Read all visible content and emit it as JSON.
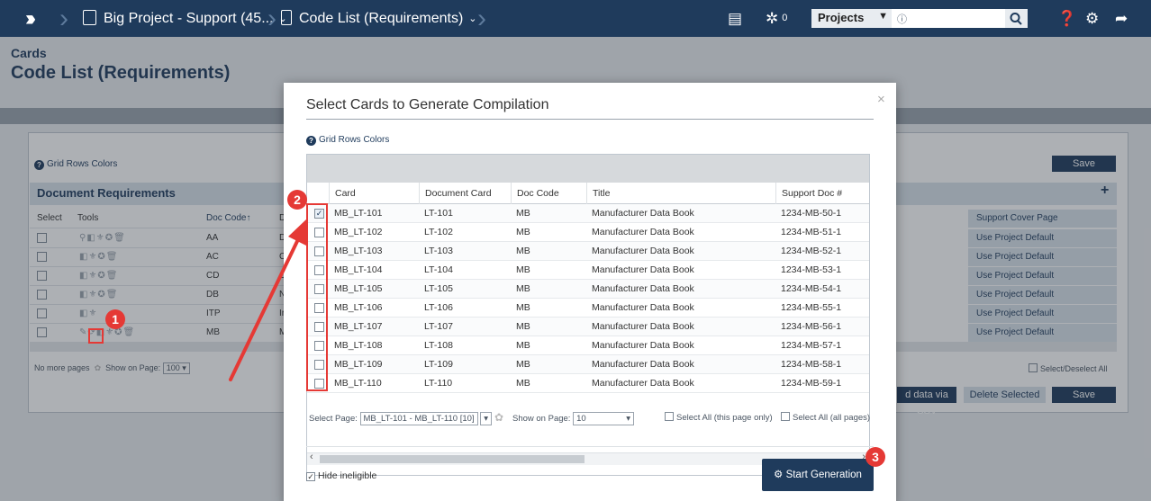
{
  "topnav": {
    "logo_icon": "chevrons-right-logo",
    "crumb1": "Big Project - Support (45...",
    "crumb2": "Code List (Requirements)",
    "notif_count": "0",
    "projects_label": "Projects",
    "search_icon": "search-icon"
  },
  "page": {
    "subtitle": "Cards",
    "title": "Code List (Requirements)",
    "grid_rows_colors": "Grid Rows Colors",
    "save": "Save",
    "section_title": "Document Requirements",
    "columns": {
      "select": "Select",
      "tools": "Tools",
      "doc_code": "Doc Code↑",
      "partial": "D",
      "support_cover": "Support Cover Page"
    },
    "rows": [
      {
        "code": "AA",
        "frag": "D",
        "cover": "Use Project Default"
      },
      {
        "code": "AC",
        "frag": "C",
        "cover": "Use Project Default"
      },
      {
        "code": "CD",
        "frag": "C",
        "cover": "Use Project Default"
      },
      {
        "code": "DB",
        "frag": "N",
        "cover": "Use Project Default"
      },
      {
        "code": "ITP",
        "frag": "Ir",
        "cover": "Use Project Default"
      },
      {
        "code": "MB",
        "frag": "M",
        "cover": "Use Project Default"
      }
    ],
    "pager_text": "No more pages",
    "show_on_page": "Show on Page:",
    "show_on_page_value": "100",
    "select_deselect": "Select/Deselect All",
    "export_csv": "d data via CSV",
    "delete_selected": "Delete Selected",
    "save_bottom": "Save"
  },
  "modal": {
    "title": "Select Cards to Generate Compilation",
    "grid_rows_colors": "Grid Rows Colors",
    "columns": [
      "Card",
      "Document Card",
      "Doc Code",
      "Title",
      "Support Doc #"
    ],
    "rows": [
      {
        "checked": true,
        "card": "MB_LT-101",
        "doc_card": "LT-101",
        "code": "MB",
        "title": "Manufacturer Data Book",
        "support": "1234-MB-50-1"
      },
      {
        "checked": false,
        "card": "MB_LT-102",
        "doc_card": "LT-102",
        "code": "MB",
        "title": "Manufacturer Data Book",
        "support": "1234-MB-51-1"
      },
      {
        "checked": false,
        "card": "MB_LT-103",
        "doc_card": "LT-103",
        "code": "MB",
        "title": "Manufacturer Data Book",
        "support": "1234-MB-52-1"
      },
      {
        "checked": false,
        "card": "MB_LT-104",
        "doc_card": "LT-104",
        "code": "MB",
        "title": "Manufacturer Data Book",
        "support": "1234-MB-53-1"
      },
      {
        "checked": false,
        "card": "MB_LT-105",
        "doc_card": "LT-105",
        "code": "MB",
        "title": "Manufacturer Data Book",
        "support": "1234-MB-54-1"
      },
      {
        "checked": false,
        "card": "MB_LT-106",
        "doc_card": "LT-106",
        "code": "MB",
        "title": "Manufacturer Data Book",
        "support": "1234-MB-55-1"
      },
      {
        "checked": false,
        "card": "MB_LT-107",
        "doc_card": "LT-107",
        "code": "MB",
        "title": "Manufacturer Data Book",
        "support": "1234-MB-56-1"
      },
      {
        "checked": false,
        "card": "MB_LT-108",
        "doc_card": "LT-108",
        "code": "MB",
        "title": "Manufacturer Data Book",
        "support": "1234-MB-57-1"
      },
      {
        "checked": false,
        "card": "MB_LT-109",
        "doc_card": "LT-109",
        "code": "MB",
        "title": "Manufacturer Data Book",
        "support": "1234-MB-58-1"
      },
      {
        "checked": false,
        "card": "MB_LT-110",
        "doc_card": "LT-110",
        "code": "MB",
        "title": "Manufacturer Data Book",
        "support": "1234-MB-59-1"
      }
    ],
    "select_page_label": "Select Page:",
    "select_page_value": "MB_LT-101 - MB_LT-110 [10]",
    "show_on_page": "Show on Page:",
    "show_on_page_value": "10",
    "select_all_page": "Select All (this page only)",
    "select_all_pages": "Select All (all pages)",
    "hide_ineligible": "Hide ineligible",
    "start_generation": "Start Generation",
    "close_glyph": "×"
  },
  "annotations": {
    "badge1": "1",
    "badge2": "2",
    "badge3": "3"
  },
  "colors": {
    "brand": "#1f3b5c",
    "annotation": "#e53935"
  }
}
